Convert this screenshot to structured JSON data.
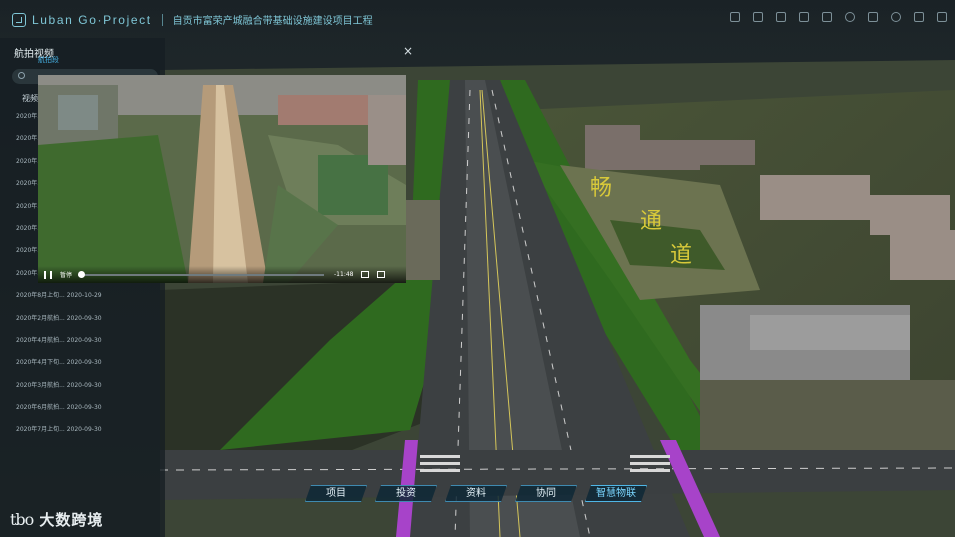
{
  "header": {
    "brand": "Luban Go·Project",
    "project_title": "自贡市富荣产城融合带基础设施建设项目工程",
    "tools": [
      "doc-icon",
      "layers-icon",
      "video-icon",
      "home-icon",
      "image-icon",
      "eye-icon",
      "grid-icon",
      "target-icon",
      "monitor-icon",
      "menu-icon"
    ]
  },
  "left_panel": {
    "title": "航拍视频",
    "tab": "航拍段",
    "column_header": "视频",
    "rows": [
      "2020年...",
      "2020年...",
      "2020年...",
      "2020年...",
      "2020年...",
      "2020年...",
      "2020年...",
      "2020年...",
      "2020年8月上旬... 2020-10-29",
      "2020年2月航拍... 2020-09-30",
      "2020年4月航拍... 2020-09-30",
      "2020年4月下旬... 2020-09-30",
      "2020年3月航拍... 2020-09-30",
      "2020年6月航拍... 2020-09-30",
      "2020年7月上旬... 2020-09-30"
    ]
  },
  "video": {
    "close": "×",
    "play_label": "暂停",
    "time": "-11:48",
    "progress": 0.01
  },
  "bottom_nav": [
    {
      "label": "项目"
    },
    {
      "label": "投资"
    },
    {
      "label": "资料"
    },
    {
      "label": "协同"
    },
    {
      "label": "智慧物联"
    }
  ],
  "watermark": {
    "mark": "tbo",
    "text": "大数跨境"
  },
  "colors": {
    "accent": "#7fc6d6",
    "link": "#46b3e6",
    "nav_border": "#3f8ab0"
  }
}
